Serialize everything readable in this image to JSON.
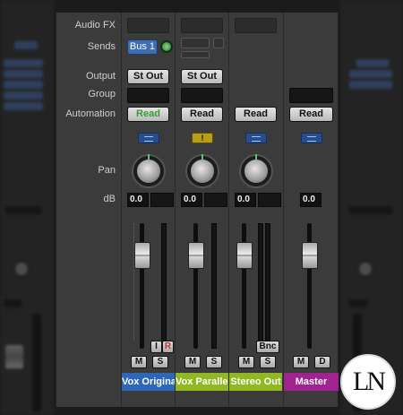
{
  "row_labels": {
    "audio_fx": "Audio FX",
    "sends": "Sends",
    "output": "Output",
    "group": "Group",
    "automation": "Automation",
    "pan": "Pan",
    "db": "dB"
  },
  "channels": [
    {
      "name": "Vox Original",
      "color": "#2d67b8",
      "send": "Bus 1",
      "output": "St Out",
      "automation": "Read",
      "db": "0.0",
      "input_button": "I",
      "record_button": "R",
      "mute": "M",
      "solo": "S"
    },
    {
      "name": "Vox Parallel",
      "color": "#8fb823",
      "output": "St Out",
      "automation": "Read",
      "db": "0.0",
      "mute": "M",
      "solo": "S"
    },
    {
      "name": "Stereo Out",
      "color": "#8fb823",
      "automation": "Read",
      "db": "0.0",
      "bounce_button": "Bnc",
      "mute": "M",
      "solo": "S"
    },
    {
      "name": "Master",
      "color": "#a0238f",
      "automation": "Read",
      "db": "0.0",
      "mute": "M",
      "dim": "D"
    }
  ],
  "logo_text": "LN",
  "colors": {
    "panel": "#3b3b3b",
    "read_green": "#3b9b35",
    "send_blue": "#3e6db4"
  },
  "icons": {
    "link_icon": "link-icon",
    "warning_icon": "alert-icon",
    "send_knob": "send-level-knob"
  }
}
